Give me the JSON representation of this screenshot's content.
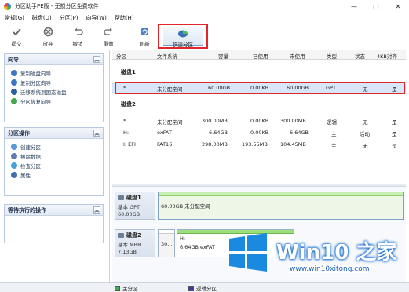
{
  "window": {
    "title": "分区助手PE版 - 无损分区免费软件",
    "controls": [
      "—",
      "□",
      "✕"
    ]
  },
  "menubar": {
    "items": [
      "常规(G)",
      "磁盘(D)",
      "分区(P)",
      "向导(W)",
      "帮助(H)"
    ]
  },
  "toolbar": {
    "buttons": [
      "提交",
      "放弃",
      "撤销",
      "重做",
      "刷新"
    ],
    "quick_partition_label": "快速分区"
  },
  "sidebar": {
    "wizard": {
      "title": "向导",
      "items": [
        "复制磁盘向导",
        "复制分区向导",
        "迁移系统到固态磁盘",
        "分区恢复向导"
      ]
    },
    "partition_ops": {
      "title": "分区操作",
      "items": [
        "创建分区",
        "擦除数据",
        "检查分区",
        "属性"
      ]
    },
    "pending": {
      "title": "等待执行的操作"
    }
  },
  "table": {
    "headers": [
      "分区",
      "文件系统",
      "容量",
      "已使用",
      "未使用",
      "类型",
      "状态",
      "4KB对齐"
    ],
    "disk1_label": "磁盘1",
    "disk1_rows": [
      [
        "*",
        "未分配空间",
        "60.00GB",
        "0.00KB",
        "60.00GB",
        "GPT",
        "无",
        "是"
      ]
    ],
    "disk2_label": "磁盘2",
    "disk2_rows": [
      [
        "*",
        "未分配空间",
        "300.00MB",
        "0.00KB",
        "300.00MB",
        "逻辑",
        "无",
        "是"
      ],
      [
        "H:",
        "exFAT",
        "6.64GB",
        "0.00KB",
        "6.64GB",
        "主",
        "活动",
        "是"
      ],
      [
        "I: EFI",
        "FAT16",
        "298.00MB",
        "193.55MB",
        "104.45MB",
        "主",
        "无",
        "是"
      ]
    ]
  },
  "diskmap": {
    "disk1": {
      "name": "磁盘1",
      "type": "基本 GPT",
      "size": "60.00GB",
      "partition_text": "60.00GB 未分配空间"
    },
    "disk2": {
      "name": "磁盘2",
      "type": "基本 MBR",
      "size": "7.13GB",
      "unalloc_text": "30...",
      "h_label": "H:",
      "h_text": "6.64GB exFAT"
    }
  },
  "statusbar": {
    "legend_primary": "主分区",
    "legend_logical": "逻辑分区"
  },
  "watermark": {
    "title": "Win10 之家",
    "url": "www.win10xitong.com"
  },
  "colors": {
    "highlight_red": "#e0262b",
    "primary_partition": "#3cb04a",
    "logical_partition": "#3b3bb0",
    "bar_green": "#9be07a"
  }
}
